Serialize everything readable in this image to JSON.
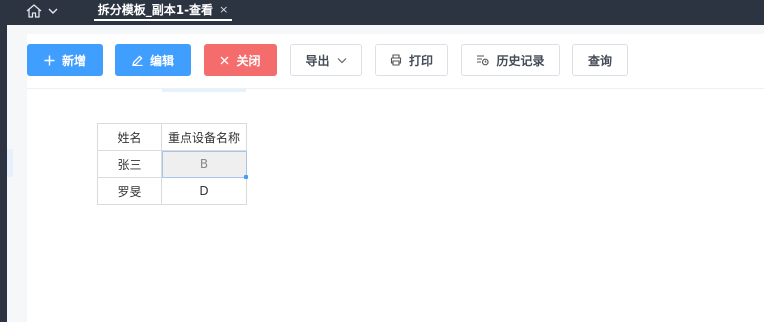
{
  "topbar": {
    "icons": [
      "home-icon",
      "chevron-down-icon"
    ],
    "active_tab": {
      "label": "拆分模板_副本1-查看",
      "close_symbol": "×"
    }
  },
  "toolbar": {
    "add": {
      "label": "新增",
      "icon": "plus-icon"
    },
    "edit": {
      "label": "编辑",
      "icon": "pencil-icon"
    },
    "close": {
      "label": "关闭",
      "icon": "close-icon"
    },
    "export": {
      "label": "导出",
      "icon": "chevron-down-icon"
    },
    "print": {
      "label": "打印",
      "icon": "printer-icon"
    },
    "history": {
      "label": "历史记录",
      "icon": "history-icon"
    },
    "query": {
      "label": "查询"
    }
  },
  "colors": {
    "topbar": "#2c3441",
    "primary": "#409eff",
    "danger": "#f56c6c",
    "selection": "#a8c4e6"
  },
  "sheet": {
    "header": [
      "姓名",
      "重点设备名称"
    ],
    "rows": [
      [
        "张三",
        "B"
      ],
      [
        "罗旻",
        "D"
      ]
    ],
    "selected_cell": "B"
  }
}
